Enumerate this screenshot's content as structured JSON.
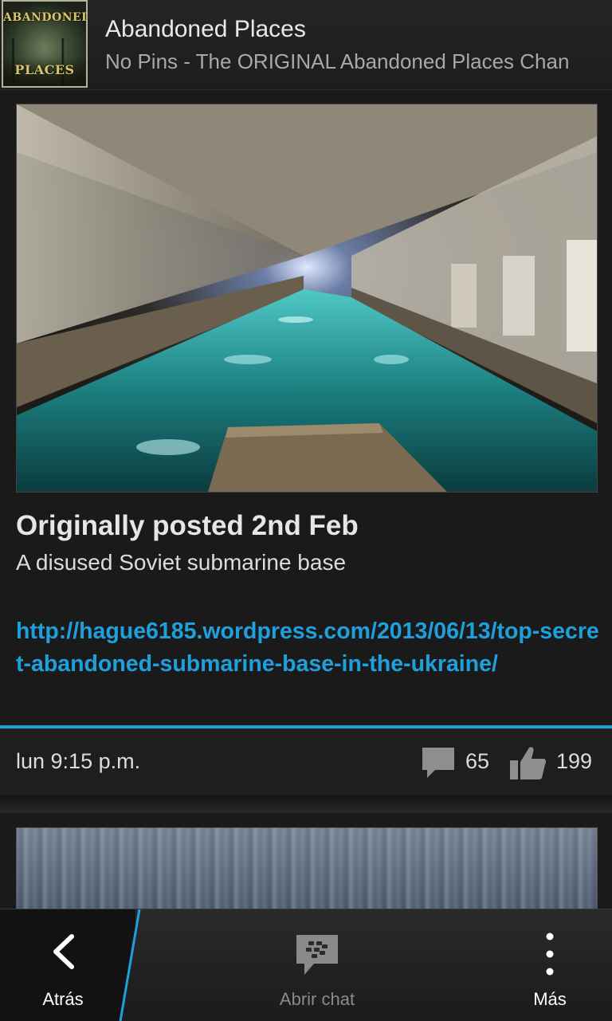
{
  "header": {
    "logo_text_top": "ABANDONED",
    "logo_text_bottom": "PLACES",
    "title": "Abandoned Places",
    "subtitle": "No Pins - The ORIGINAL Abandoned Places Chan"
  },
  "post": {
    "image_icon": "tunnel-photo",
    "heading": "Originally posted 2nd Feb",
    "text": "A disused Soviet submarine base",
    "link": "http://hague6185.wordpress.com/2013/06/13/top-secret-abandoned-submarine-base-in-the-ukraine/",
    "timestamp": "lun 9:15 p.m.",
    "comments": "65",
    "likes": "199"
  },
  "colors": {
    "accent": "#1ea0dc",
    "background": "#1a1a1b"
  },
  "action_bar": {
    "back_label": "Atrás",
    "chat_label": "Abrir chat",
    "more_label": "Más"
  }
}
